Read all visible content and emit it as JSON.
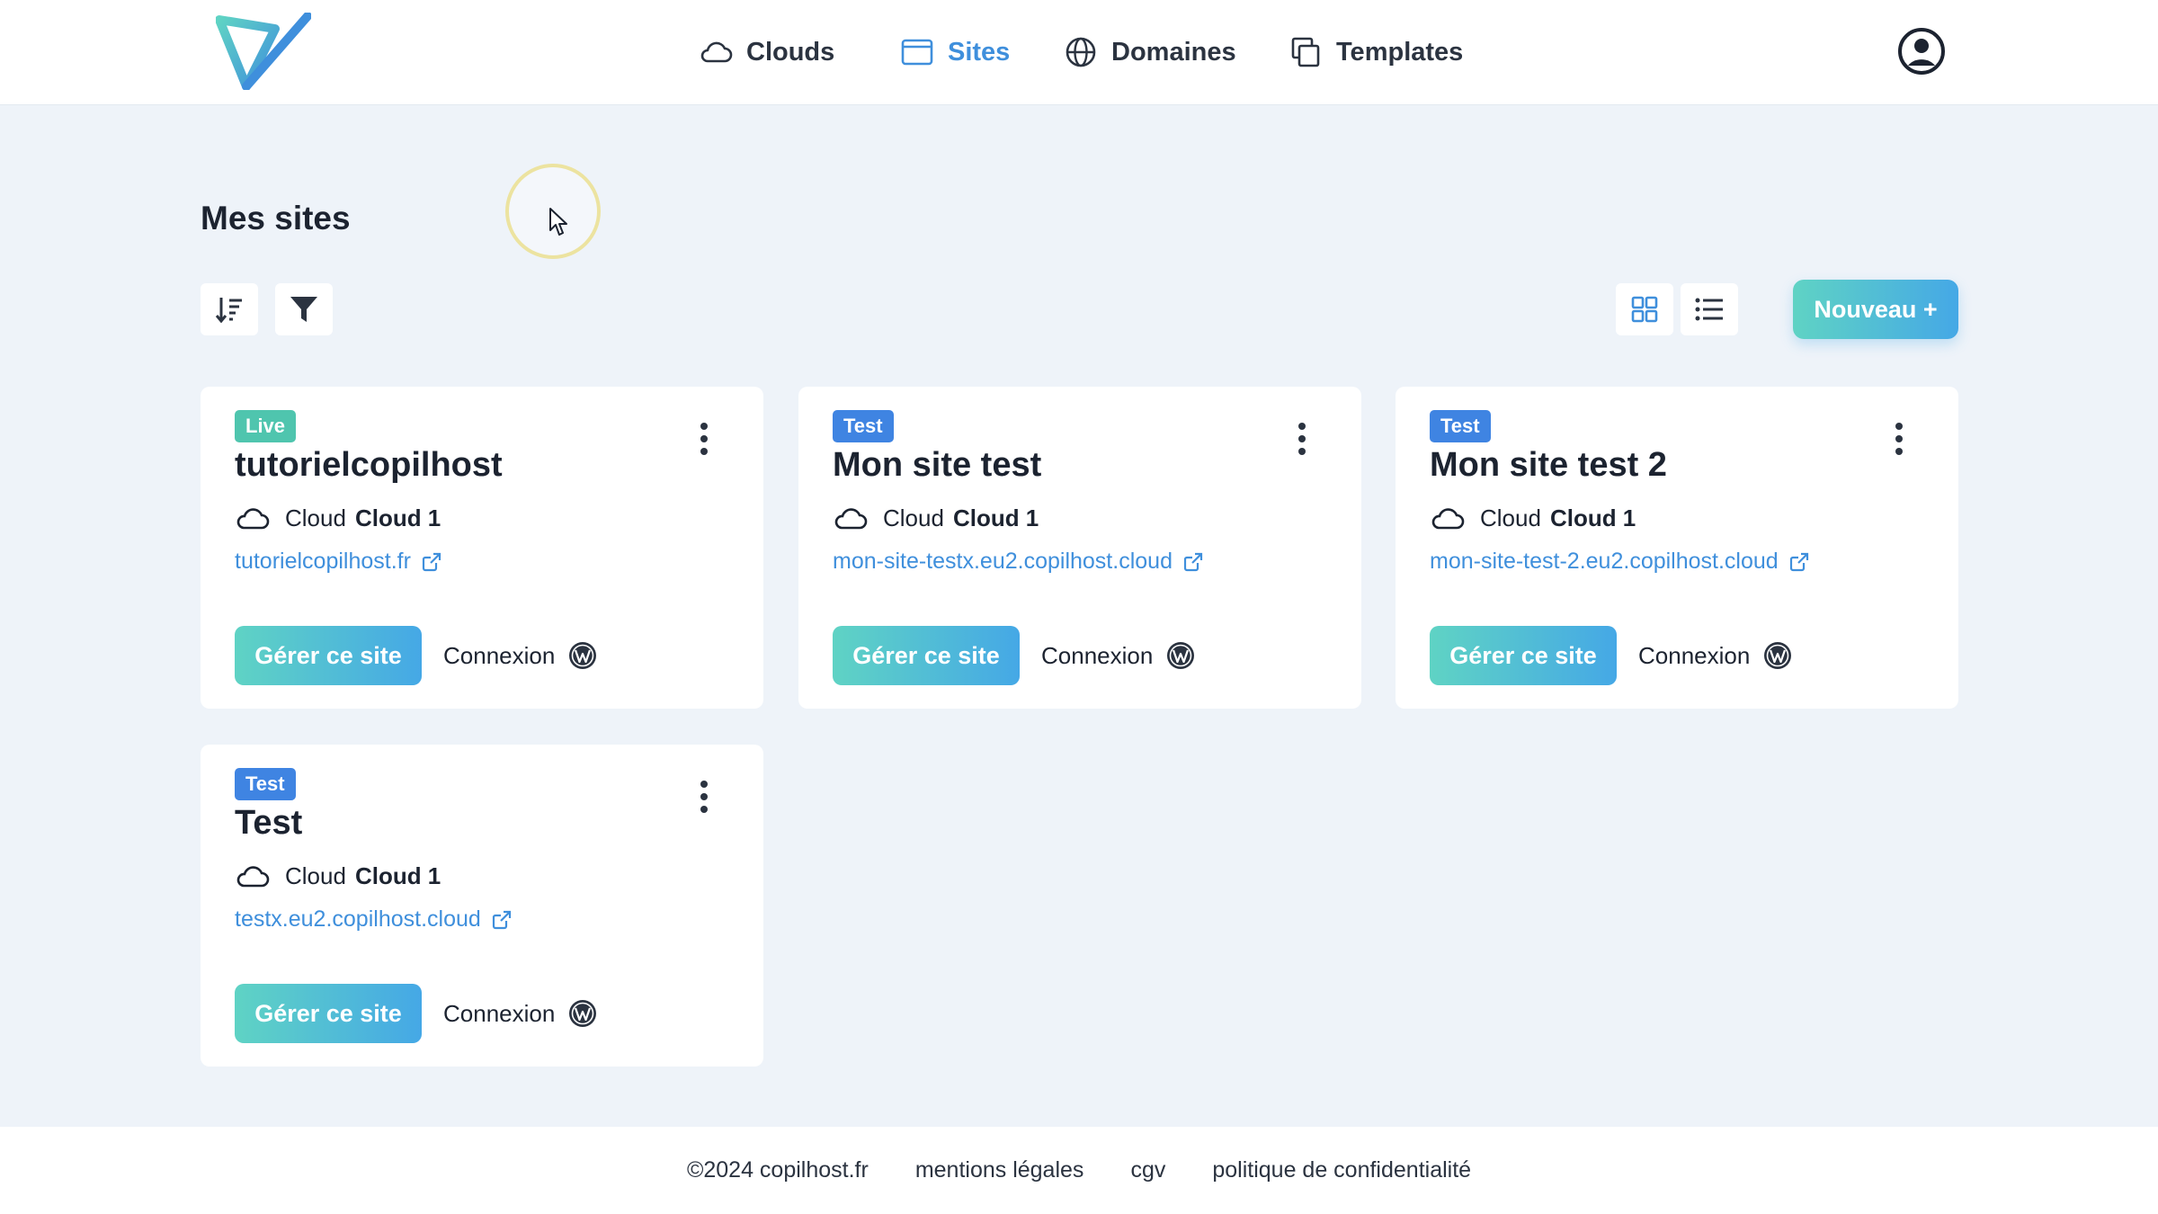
{
  "nav": {
    "items": [
      {
        "label": "Clouds",
        "icon": "cloud-icon"
      },
      {
        "label": "Sites",
        "icon": "browser-window-icon",
        "active": true
      },
      {
        "label": "Domaines",
        "icon": "globe-icon"
      },
      {
        "label": "Templates",
        "icon": "copy-icon"
      }
    ]
  },
  "page": {
    "title": "Mes sites"
  },
  "toolbar": {
    "new_label": "Nouveau +"
  },
  "colors": {
    "accent": "#3f8fdc",
    "gradient_start": "#5fd3c4",
    "gradient_end": "#45a8e6",
    "live": "#4fc5ae",
    "test": "#3f84e2"
  },
  "sites": [
    {
      "badge": "Live",
      "name": "tutorielcopilhost",
      "cloud_label": "Cloud",
      "cloud_name": "Cloud 1",
      "url": "tutorielcopilhost.fr",
      "manage_label": "Gérer ce site",
      "login_label": "Connexion"
    },
    {
      "badge": "Test",
      "name": "Mon site test",
      "cloud_label": "Cloud",
      "cloud_name": "Cloud 1",
      "url": "mon-site-testx.eu2.copilhost.cloud",
      "manage_label": "Gérer ce site",
      "login_label": "Connexion"
    },
    {
      "badge": "Test",
      "name": "Mon site test 2",
      "cloud_label": "Cloud",
      "cloud_name": "Cloud 1",
      "url": "mon-site-test-2.eu2.copilhost.cloud",
      "manage_label": "Gérer ce site",
      "login_label": "Connexion"
    },
    {
      "badge": "Test",
      "name": "Test",
      "cloud_label": "Cloud",
      "cloud_name": "Cloud 1",
      "url": "testx.eu2.copilhost.cloud",
      "manage_label": "Gérer ce site",
      "login_label": "Connexion"
    }
  ],
  "footer": {
    "copyright": "©2024 copilhost.fr",
    "links": [
      "mentions légales",
      "cgv",
      "politique de confidentialité"
    ]
  }
}
